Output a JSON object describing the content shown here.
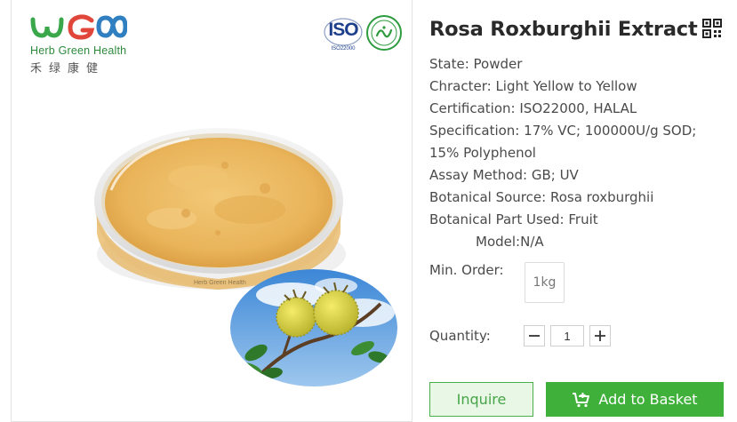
{
  "brand": {
    "name_en": "Herb Green Health",
    "name_cn": "禾绿康健",
    "colors": {
      "green": "#3aa84a",
      "blue": "#2f7fc1",
      "red": "#e0473a"
    }
  },
  "certifications": {
    "iso_label": "ISO",
    "iso_code": "ISO22000",
    "halal_icon": "halal-seal-icon"
  },
  "product": {
    "title": "Rosa Roxburghii Extract",
    "specs": [
      {
        "label": "State:",
        "value": "Powder"
      },
      {
        "label": "Chracter:",
        "value": "Light Yellow to Yellow"
      },
      {
        "label": "Certification:",
        "value": "ISO22000, HALAL"
      },
      {
        "label": "Specification:",
        "value": "17% VC; 100000U/g SOD; 15% Polyphenol"
      },
      {
        "label": "Assay Method:",
        "value": "GB; UV"
      },
      {
        "label": "Botanical Source:",
        "value": "Rosa roxburghii"
      },
      {
        "label": "Botanical Part Used:",
        "value": "Fruit"
      }
    ],
    "model": {
      "label": "Model:",
      "value": "N/A"
    }
  },
  "order": {
    "min_order_label": "Min. Order:",
    "min_order_value": "1kg",
    "quantity_label": "Quantity:",
    "quantity_value": "1"
  },
  "actions": {
    "inquire_label": "Inquire",
    "basket_label": "Add to Basket",
    "accent": "#3fb03a"
  }
}
